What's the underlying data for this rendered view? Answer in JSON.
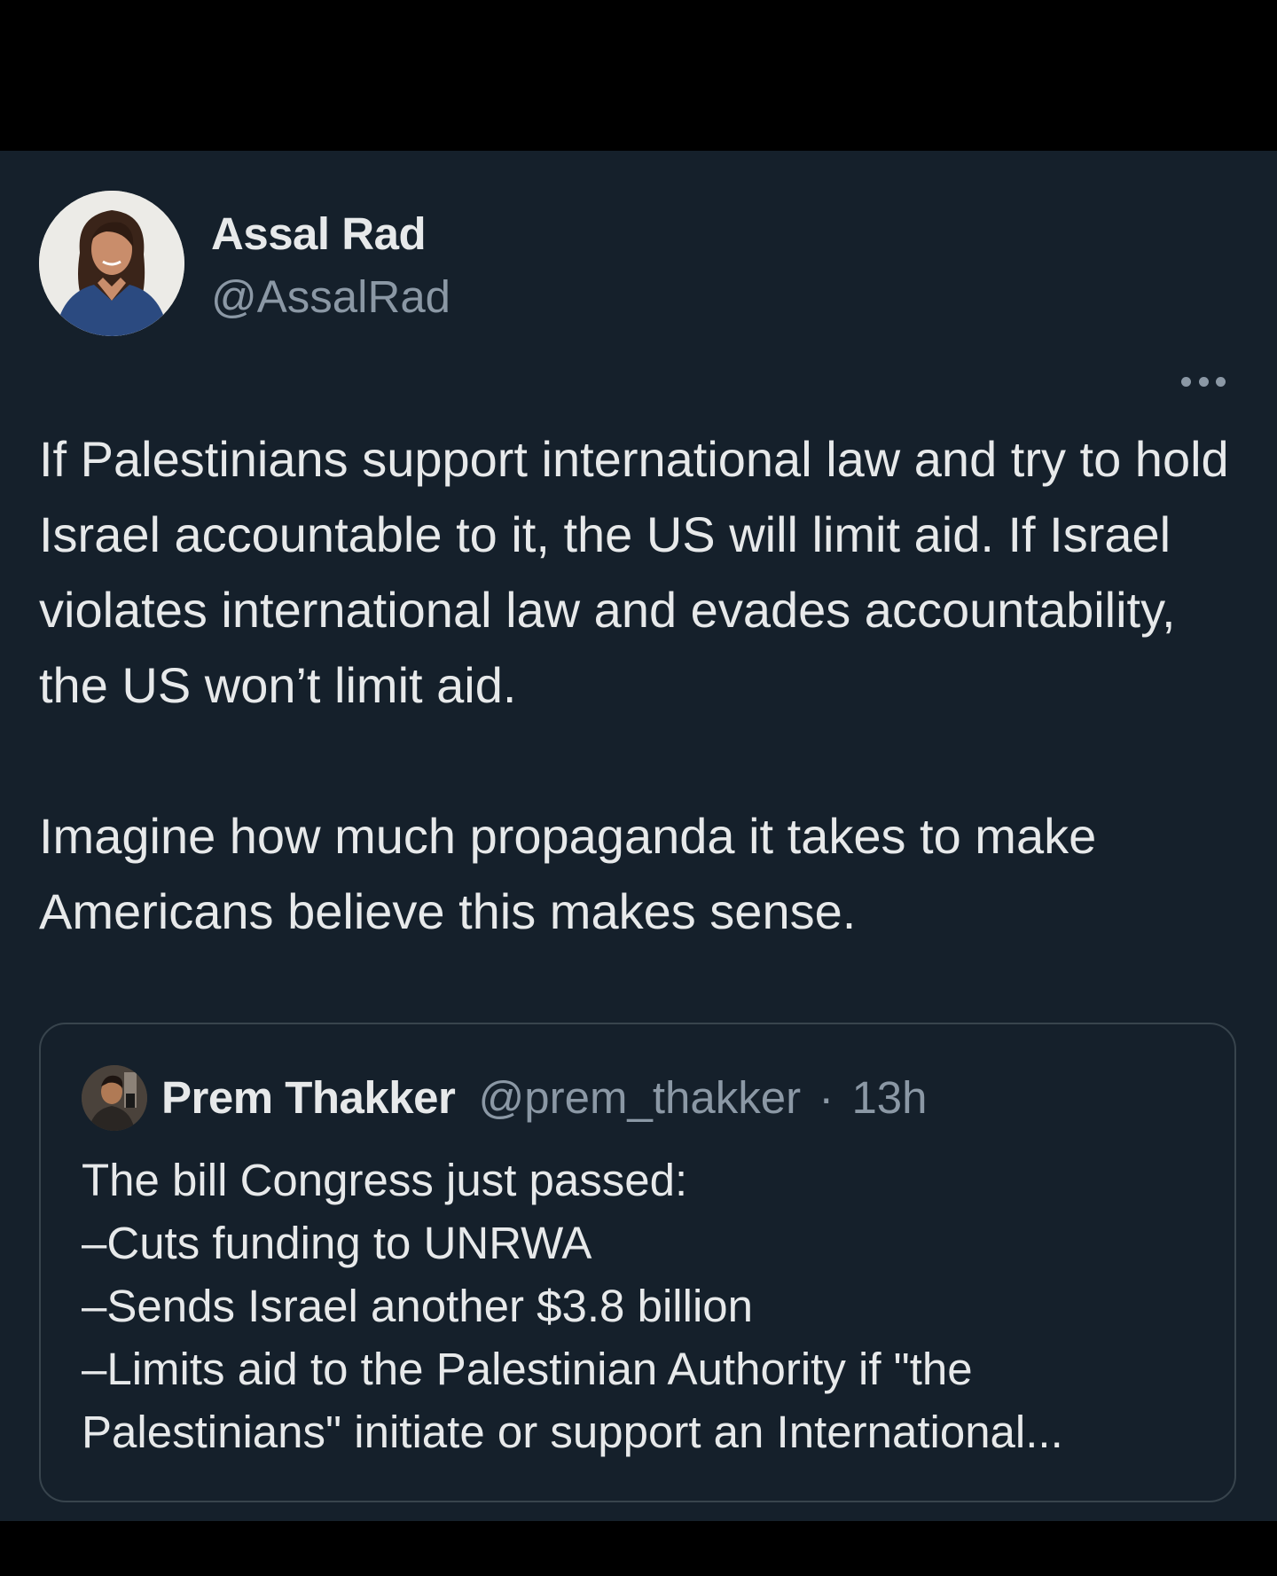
{
  "tweet": {
    "author": {
      "name": "Assal Rad",
      "handle": "@AssalRad"
    },
    "text_paragraphs": [
      "If Palestinians support international law and try to hold Israel accountable to it, the US will limit aid. If Israel violates international law and evades accountability, the US won’t limit aid.",
      "Imagine how much propaganda it takes to make Americans believe this makes sense."
    ],
    "more_icon": "more-horizontal-icon"
  },
  "quoted_tweet": {
    "author": {
      "name": "Prem Thakker",
      "handle": "@prem_thakker"
    },
    "separator": "·",
    "time": "13h",
    "lines": [
      "The bill Congress just passed:",
      "–Cuts funding to UNRWA",
      "–Sends Israel another $3.8 billion",
      "–Limits aid to the Palestinian Authority if \"the",
      "Palestinians\" initiate or support an International..."
    ]
  },
  "colors": {
    "background": "#15202b",
    "frame": "#000000",
    "primary_text": "#e7e9ea",
    "secondary_text": "#8b98a5",
    "border": "#38444d"
  }
}
